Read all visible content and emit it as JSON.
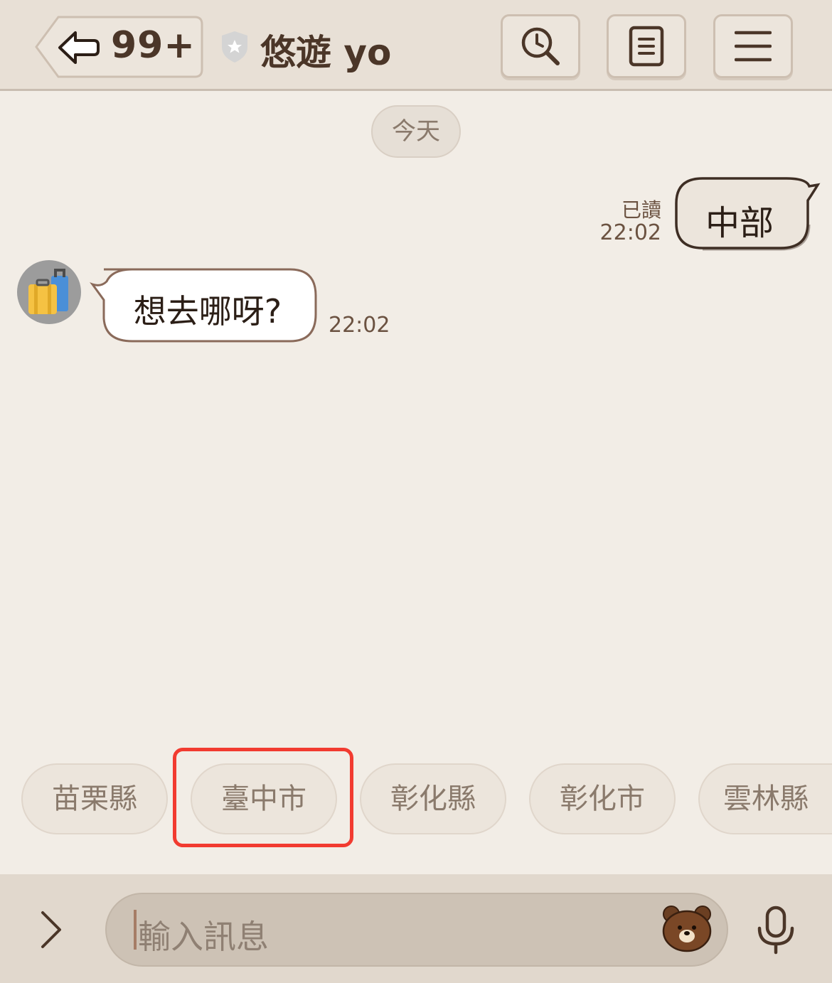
{
  "header": {
    "unread_count": "99+",
    "title": "悠遊 yo",
    "icons": [
      "back-arrow-icon",
      "shield-star-icon",
      "search-clock-icon",
      "notes-icon",
      "menu-icon"
    ]
  },
  "chat": {
    "date_label": "今天",
    "messages": [
      {
        "side": "sent",
        "text": "中部",
        "status": "已讀",
        "time": "22:02"
      },
      {
        "side": "received",
        "text": "想去哪呀?",
        "time": "22:02",
        "avatar": "suitcase-avatar"
      }
    ]
  },
  "quick_replies": [
    "苗栗縣",
    "臺中市",
    "彰化縣",
    "彰化市",
    "雲林縣"
  ],
  "highlight": {
    "target": "臺中市",
    "color": "#f23b30"
  },
  "input": {
    "placeholder": "輸入訊息"
  },
  "colors": {
    "header_bg": "#e8e0d6",
    "chat_bg": "#f2ede6",
    "accent_brown": "#4b3628",
    "input_bar": "#e1d8cd"
  }
}
